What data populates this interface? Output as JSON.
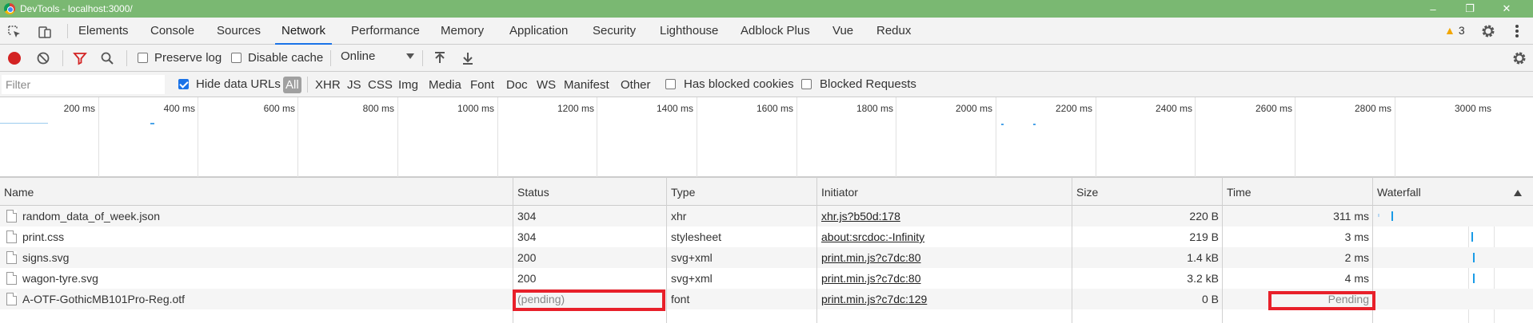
{
  "window": {
    "title": "DevTools - localhost:3000/"
  },
  "window_controls": {
    "minimize": "–",
    "restore": "❐",
    "close": "✕"
  },
  "tabs": [
    "Elements",
    "Console",
    "Sources",
    "Network",
    "Performance",
    "Memory",
    "Application",
    "Security",
    "Lighthouse",
    "Adblock Plus",
    "Vue",
    "Redux"
  ],
  "active_tab": "Network",
  "warnings_count": "3",
  "toolbar": {
    "preserve_log": "Preserve log",
    "disable_cache": "Disable cache",
    "throttling": "Online"
  },
  "filterbar": {
    "placeholder": "Filter",
    "hide_data_urls": "Hide data URLs",
    "types": [
      "All",
      "XHR",
      "JS",
      "CSS",
      "Img",
      "Media",
      "Font",
      "Doc",
      "WS",
      "Manifest",
      "Other"
    ],
    "has_blocked_cookies": "Has blocked cookies",
    "blocked_requests": "Blocked Requests"
  },
  "overview": {
    "ticks": [
      "200 ms",
      "400 ms",
      "600 ms",
      "800 ms",
      "1000 ms",
      "1200 ms",
      "1400 ms",
      "1600 ms",
      "1800 ms",
      "2000 ms",
      "2200 ms",
      "2400 ms",
      "2600 ms",
      "2800 ms",
      "3000 ms"
    ]
  },
  "table": {
    "columns": [
      "Name",
      "Status",
      "Type",
      "Initiator",
      "Size",
      "Time",
      "Waterfall"
    ],
    "rows": [
      {
        "name": "random_data_of_week.json",
        "status": "304",
        "type": "xhr",
        "initiator": "xhr.js?b50d:178",
        "size": "220 B",
        "time": "311 ms"
      },
      {
        "name": "print.css",
        "status": "304",
        "type": "stylesheet",
        "initiator": "about:srcdoc:-Infinity",
        "size": "219 B",
        "time": "3 ms"
      },
      {
        "name": "signs.svg",
        "status": "200",
        "type": "svg+xml",
        "initiator": "print.min.js?c7dc:80",
        "size": "1.4 kB",
        "time": "2 ms"
      },
      {
        "name": "wagon-tyre.svg",
        "status": "200",
        "type": "svg+xml",
        "initiator": "print.min.js?c7dc:80",
        "size": "3.2 kB",
        "time": "4 ms"
      },
      {
        "name": "A-OTF-GothicMB101Pro-Reg.otf",
        "status": "(pending)",
        "type": "font",
        "initiator": "print.min.js?c7dc:129",
        "size": "0 B",
        "time": "Pending"
      }
    ]
  },
  "colors": {
    "accent": "#1a73e8",
    "record": "#d32323",
    "highlight": "#e8202a",
    "titlebar": "#7ab872",
    "waterfall": "#1a9be6"
  }
}
